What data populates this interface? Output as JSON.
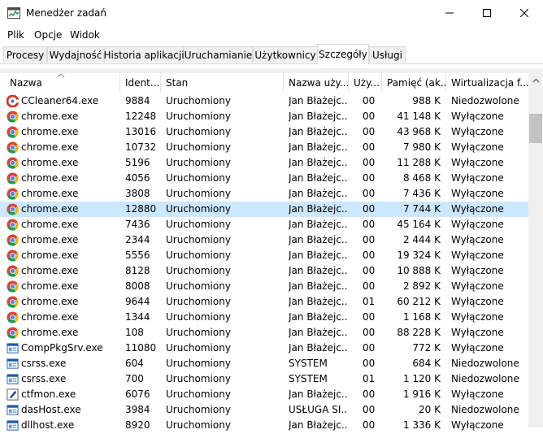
{
  "window": {
    "title": "Menedżer zadań"
  },
  "menu": [
    "Plik",
    "Opcje",
    "Widok"
  ],
  "tabs": [
    "Procesy",
    "Wydajność",
    "Historia aplikacji",
    "Uruchamianie",
    "Użytkownicy",
    "Szczegóły",
    "Usługi"
  ],
  "active_tab": "Szczegóły",
  "columns": [
    "Nazwa",
    "Ident...",
    "Stan",
    "Nazwa uży...",
    "Uży...",
    "Pamięć (ak...",
    "Wirtualizacja f..."
  ],
  "rows": [
    {
      "name": "CCleaner64.exe",
      "pid": "9884",
      "status": "Uruchomiony",
      "user": "Jan Błażejc...",
      "cpu": "00",
      "mem": "988 K",
      "virt": "Niedozwolone",
      "icon": "ccleaner-icon"
    },
    {
      "name": "chrome.exe",
      "pid": "12248",
      "status": "Uruchomiony",
      "user": "Jan Błażejc...",
      "cpu": "00",
      "mem": "41 148 K",
      "virt": "Wyłączone",
      "icon": "chrome-icon"
    },
    {
      "name": "chrome.exe",
      "pid": "13016",
      "status": "Uruchomiony",
      "user": "Jan Błażejc...",
      "cpu": "00",
      "mem": "43 968 K",
      "virt": "Wyłączone",
      "icon": "chrome-icon"
    },
    {
      "name": "chrome.exe",
      "pid": "10732",
      "status": "Uruchomiony",
      "user": "Jan Błażejc...",
      "cpu": "00",
      "mem": "7 980 K",
      "virt": "Wyłączone",
      "icon": "chrome-icon"
    },
    {
      "name": "chrome.exe",
      "pid": "5196",
      "status": "Uruchomiony",
      "user": "Jan Błażejc...",
      "cpu": "00",
      "mem": "11 288 K",
      "virt": "Wyłączone",
      "icon": "chrome-icon"
    },
    {
      "name": "chrome.exe",
      "pid": "4056",
      "status": "Uruchomiony",
      "user": "Jan Błażejc...",
      "cpu": "00",
      "mem": "8 468 K",
      "virt": "Wyłączone",
      "icon": "chrome-icon"
    },
    {
      "name": "chrome.exe",
      "pid": "3808",
      "status": "Uruchomiony",
      "user": "Jan Błażejc...",
      "cpu": "00",
      "mem": "7 436 K",
      "virt": "Wyłączone",
      "icon": "chrome-icon"
    },
    {
      "name": "chrome.exe",
      "pid": "12880",
      "status": "Uruchomiony",
      "user": "Jan Błażejc...",
      "cpu": "00",
      "mem": "7 744 K",
      "virt": "Wyłączone",
      "icon": "chrome-icon",
      "selected": true
    },
    {
      "name": "chrome.exe",
      "pid": "7436",
      "status": "Uruchomiony",
      "user": "Jan Błażejc...",
      "cpu": "00",
      "mem": "45 164 K",
      "virt": "Wyłączone",
      "icon": "chrome-icon"
    },
    {
      "name": "chrome.exe",
      "pid": "2344",
      "status": "Uruchomiony",
      "user": "Jan Błażejc...",
      "cpu": "00",
      "mem": "2 444 K",
      "virt": "Wyłączone",
      "icon": "chrome-icon"
    },
    {
      "name": "chrome.exe",
      "pid": "5556",
      "status": "Uruchomiony",
      "user": "Jan Błażejc...",
      "cpu": "00",
      "mem": "19 324 K",
      "virt": "Wyłączone",
      "icon": "chrome-icon"
    },
    {
      "name": "chrome.exe",
      "pid": "8128",
      "status": "Uruchomiony",
      "user": "Jan Błażejc...",
      "cpu": "00",
      "mem": "10 888 K",
      "virt": "Wyłączone",
      "icon": "chrome-icon"
    },
    {
      "name": "chrome.exe",
      "pid": "8008",
      "status": "Uruchomiony",
      "user": "Jan Błażejc...",
      "cpu": "00",
      "mem": "2 892 K",
      "virt": "Wyłączone",
      "icon": "chrome-icon"
    },
    {
      "name": "chrome.exe",
      "pid": "9644",
      "status": "Uruchomiony",
      "user": "Jan Błażejc...",
      "cpu": "01",
      "mem": "60 212 K",
      "virt": "Wyłączone",
      "icon": "chrome-icon"
    },
    {
      "name": "chrome.exe",
      "pid": "1344",
      "status": "Uruchomiony",
      "user": "Jan Błażejc...",
      "cpu": "00",
      "mem": "1 168 K",
      "virt": "Wyłączone",
      "icon": "chrome-icon"
    },
    {
      "name": "chrome.exe",
      "pid": "108",
      "status": "Uruchomiony",
      "user": "Jan Błażejc...",
      "cpu": "00",
      "mem": "88 228 K",
      "virt": "Wyłączone",
      "icon": "chrome-icon"
    },
    {
      "name": "CompPkgSrv.exe",
      "pid": "11080",
      "status": "Uruchomiony",
      "user": "Jan Błażejc...",
      "cpu": "00",
      "mem": "772 K",
      "virt": "Wyłączone",
      "icon": "window-app-icon"
    },
    {
      "name": "csrss.exe",
      "pid": "604",
      "status": "Uruchomiony",
      "user": "SYSTEM",
      "cpu": "00",
      "mem": "684 K",
      "virt": "Niedozwolone",
      "icon": "window-app-icon"
    },
    {
      "name": "csrss.exe",
      "pid": "700",
      "status": "Uruchomiony",
      "user": "SYSTEM",
      "cpu": "01",
      "mem": "1 120 K",
      "virt": "Niedozwolone",
      "icon": "window-app-icon"
    },
    {
      "name": "ctfmon.exe",
      "pid": "6076",
      "status": "Uruchomiony",
      "user": "Jan Błażejc...",
      "cpu": "00",
      "mem": "1 916 K",
      "virt": "Wyłączone",
      "icon": "pen-icon"
    },
    {
      "name": "dasHost.exe",
      "pid": "3984",
      "status": "Uruchomiony",
      "user": "USŁUGA SI...",
      "cpu": "00",
      "mem": "20 K",
      "virt": "Niedozwolone",
      "icon": "window-app-icon"
    },
    {
      "name": "dllhost.exe",
      "pid": "8920",
      "status": "Uruchomiony",
      "user": "Jan Błażejc...",
      "cpu": "00",
      "mem": "1 336 K",
      "virt": "Wyłączone",
      "icon": "window-app-icon"
    }
  ],
  "colors": {
    "selected_row": "#cce8ff",
    "tab_bg": "#f0f0f0",
    "border": "#d9d9d9"
  }
}
